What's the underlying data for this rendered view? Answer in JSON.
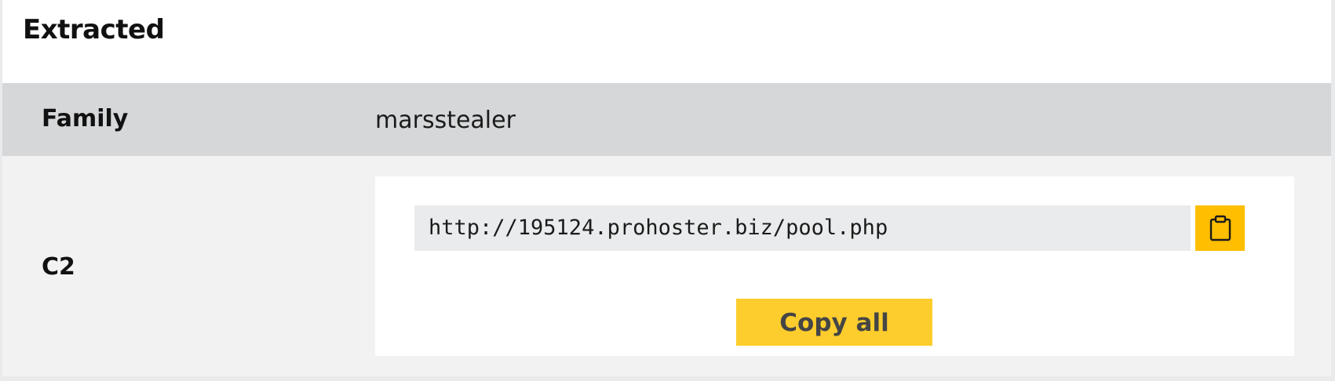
{
  "section": {
    "title": "Extracted"
  },
  "family": {
    "label": "Family",
    "value": "marsstealer"
  },
  "c2": {
    "label": "C2",
    "urls": [
      "http://195124.prohoster.biz/pool.php"
    ],
    "copy_icon": "clipboard-icon",
    "copy_all_label": "Copy all"
  },
  "colors": {
    "accent": "#ffbe00",
    "button": "#fdcd2d",
    "family_row": "#d6d7d9",
    "c2_row": "#f2f2f2"
  }
}
